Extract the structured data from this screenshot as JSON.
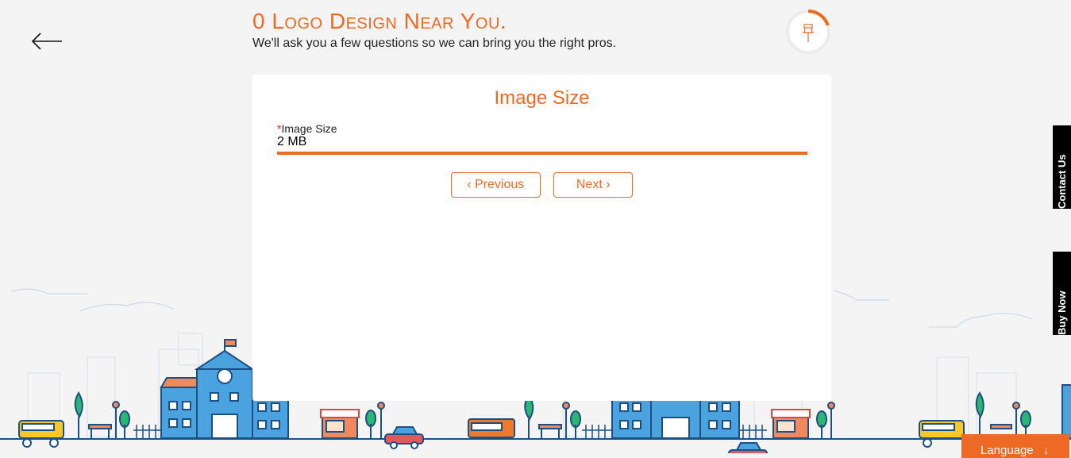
{
  "header": {
    "title": "0 Logo Design Near You.",
    "subtitle": "We'll ask you a few questions so we can bring you the right pros."
  },
  "progress": {
    "percent": 20,
    "icon": "pushpin-icon"
  },
  "card": {
    "title": "Image Size",
    "field": {
      "required_mark": "*",
      "label": "Image Size",
      "value": "2 MB"
    },
    "prev_label": "‹ Previous",
    "next_label": "Next ›"
  },
  "side_tabs": {
    "contact": "Contact Us",
    "buy": "Buy Now"
  },
  "language_button": {
    "label": "Language",
    "icon": "arrow-down-icon"
  },
  "colors": {
    "accent": "#ee6a24",
    "building": "#4aa3df",
    "tree": "#2bb673",
    "outline": "#1d4f84"
  }
}
